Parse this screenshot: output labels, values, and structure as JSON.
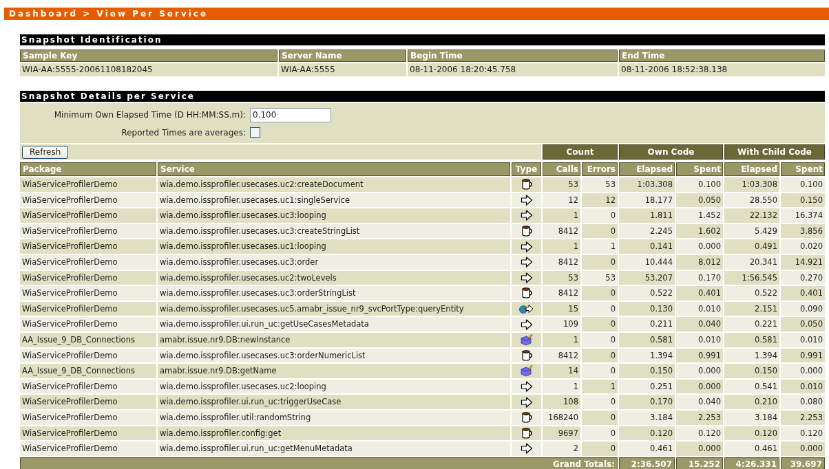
{
  "breadcrumb": "Dashboard > View Per Service",
  "identification": {
    "title": "Snapshot Identification",
    "columns": [
      "Sample Key",
      "Server Name",
      "Begin Time",
      "End Time"
    ],
    "values": [
      "WIA-AA:5555-20061108182045",
      "WIA-AA:5555",
      "08-11-2006 18:20:45.758",
      "08-11-2006 18:52:38.138"
    ]
  },
  "details": {
    "title": "Snapshot Details per Service",
    "min_elapsed": {
      "label": "Minimum Own Elapsed Time (D HH:MM:SS.m):",
      "value": "0.100"
    },
    "averages": {
      "label": "Reported Times are averages:",
      "checked": false
    },
    "refresh_button": "Refresh",
    "column_groups": [
      "Count",
      "Own Code",
      "With Child Code"
    ],
    "columns": [
      "Package",
      "Service",
      "Type",
      "Calls",
      "Errors",
      "Elapsed",
      "Spent",
      "Elapsed",
      "Spent"
    ],
    "rows": [
      {
        "package": "WiaServiceProfilerDemo",
        "service": "wia.demo.issprofiler.usecases.uc2:createDocument",
        "kind": "java",
        "values": [
          "53",
          "53",
          "1:03.308",
          "0.100",
          "1:03.308",
          "0.100"
        ]
      },
      {
        "package": "WiaServiceProfilerDemo",
        "service": "wia.demo.issprofiler.usecases.uc1:singleService",
        "kind": "flow",
        "values": [
          "12",
          "12",
          "18.177",
          "0.050",
          "28.550",
          "0.150"
        ]
      },
      {
        "package": "WiaServiceProfilerDemo",
        "service": "wia.demo.issprofiler.usecases.uc3:looping",
        "kind": "flow",
        "values": [
          "1",
          "0",
          "1.811",
          "1.452",
          "22.132",
          "16.374"
        ]
      },
      {
        "package": "WiaServiceProfilerDemo",
        "service": "wia.demo.issprofiler.usecases.uc3:createStringList",
        "kind": "java",
        "values": [
          "8412",
          "0",
          "2.245",
          "1.602",
          "5.429",
          "3.856"
        ]
      },
      {
        "package": "WiaServiceProfilerDemo",
        "service": "wia.demo.issprofiler.usecases.uc1:looping",
        "kind": "flow",
        "values": [
          "1",
          "1",
          "0.141",
          "0.000",
          "0.491",
          "0.020"
        ]
      },
      {
        "package": "WiaServiceProfilerDemo",
        "service": "wia.demo.issprofiler.usecases.uc3:order",
        "kind": "flow",
        "values": [
          "8412",
          "0",
          "10.444",
          "8.012",
          "20.341",
          "14.921"
        ]
      },
      {
        "package": "WiaServiceProfilerDemo",
        "service": "wia.demo.issprofiler.usecases.uc2:twoLevels",
        "kind": "flow",
        "values": [
          "53",
          "53",
          "53.207",
          "0.170",
          "1:56.545",
          "0.270"
        ]
      },
      {
        "package": "WiaServiceProfilerDemo",
        "service": "wia.demo.issprofiler.usecases.uc3:orderStringList",
        "kind": "java",
        "values": [
          "8412",
          "0",
          "0.522",
          "0.401",
          "0.522",
          "0.401"
        ]
      },
      {
        "package": "WiaServiceProfilerDemo",
        "service": "wia.demo.issprofiler.usecases.uc5.amabr_issue_nr9_svcPortType:queryEntity",
        "kind": "webservice",
        "values": [
          "15",
          "0",
          "0.130",
          "0.010",
          "2.151",
          "0.090"
        ]
      },
      {
        "package": "WiaServiceProfilerDemo",
        "service": "wia.demo.issprofiler.ui.run_uc:getUseCasesMetadata",
        "kind": "flow",
        "values": [
          "109",
          "0",
          "0.211",
          "0.040",
          "0.221",
          "0.050"
        ]
      },
      {
        "package": "AA_Issue_9_DB_Connections",
        "service": "amabr.issue.nr9.DB:newInstance",
        "kind": "adapter",
        "values": [
          "1",
          "0",
          "0.581",
          "0.010",
          "0.581",
          "0.010"
        ]
      },
      {
        "package": "WiaServiceProfilerDemo",
        "service": "wia.demo.issprofiler.usecases.uc3:orderNumericList",
        "kind": "java",
        "values": [
          "8412",
          "0",
          "1.394",
          "0.991",
          "1.394",
          "0.991"
        ]
      },
      {
        "package": "AA_Issue_9_DB_Connections",
        "service": "amabr.issue.nr9.DB:getName",
        "kind": "adapter",
        "values": [
          "14",
          "0",
          "0.150",
          "0.000",
          "0.150",
          "0.000"
        ]
      },
      {
        "package": "WiaServiceProfilerDemo",
        "service": "wia.demo.issprofiler.usecases.uc2:looping",
        "kind": "flow",
        "values": [
          "1",
          "1",
          "0.251",
          "0.000",
          "0.541",
          "0.010"
        ]
      },
      {
        "package": "WiaServiceProfilerDemo",
        "service": "wia.demo.issprofiler.ui.run_uc:triggerUseCase",
        "kind": "flow",
        "values": [
          "108",
          "0",
          "0.170",
          "0.040",
          "0.210",
          "0.080"
        ]
      },
      {
        "package": "WiaServiceProfilerDemo",
        "service": "wia.demo.issprofiler.util:randomString",
        "kind": "java",
        "values": [
          "168240",
          "0",
          "3.184",
          "2.253",
          "3.184",
          "2.253"
        ]
      },
      {
        "package": "WiaServiceProfilerDemo",
        "service": "wia.demo.issprofiler.config:get",
        "kind": "java",
        "values": [
          "9697",
          "0",
          "0.120",
          "0.120",
          "0.120",
          "0.120"
        ]
      },
      {
        "package": "WiaServiceProfilerDemo",
        "service": "wia.demo.issprofiler.ui.run_uc:getMenuMetadata",
        "kind": "flow",
        "values": [
          "2",
          "0",
          "0.461",
          "0.000",
          "0.461",
          "0.000"
        ]
      }
    ],
    "totals": {
      "label": "Grand Totals:",
      "values": [
        "2:36.507",
        "15.252",
        "4:26.331",
        "39.697"
      ]
    }
  }
}
